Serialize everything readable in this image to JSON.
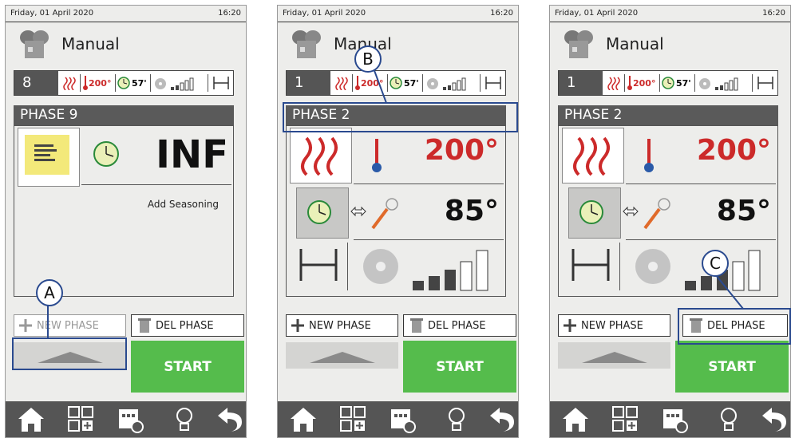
{
  "status": {
    "date": "Friday, 01 April 2020",
    "time": "16:20"
  },
  "header": {
    "title": "Manual"
  },
  "summary": {
    "temperature": "200°",
    "time": "57'"
  },
  "panel_a": {
    "phase_num": "8",
    "phase_title": "PHASE 9",
    "big_value": "INF",
    "note_text": "Add Seasoning"
  },
  "panel_b": {
    "phase_num": "1",
    "phase_title": "PHASE 2",
    "temp_value": "200°",
    "core_value": "85°"
  },
  "panel_c": {
    "phase_num": "1",
    "phase_title": "PHASE 2",
    "temp_value": "200°",
    "core_value": "85°"
  },
  "buttons": {
    "new_phase": "NEW PHASE",
    "del_phase": "DEL PHASE",
    "start": "START"
  },
  "callouts": {
    "a": "A",
    "b": "B",
    "c": "C"
  },
  "colors": {
    "accent_red": "#cc2a2a",
    "start_green": "#55bc4c",
    "callout_blue": "#2a4a8f",
    "dark_bar": "#555555"
  }
}
